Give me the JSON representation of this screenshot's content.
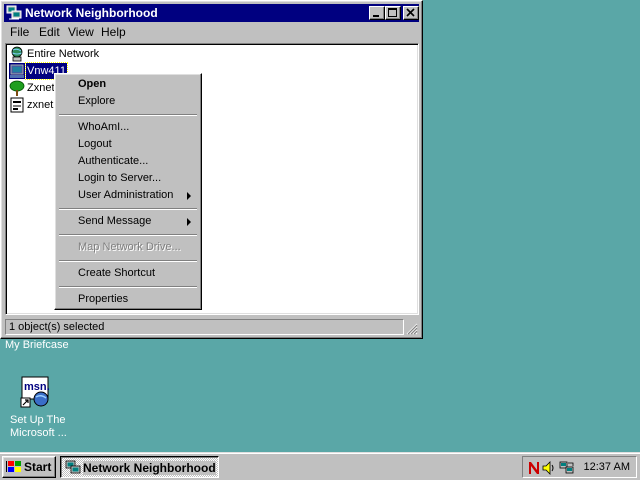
{
  "desktop": {
    "briefcase_label": "My Briefcase",
    "msn_icon_text": "msn.",
    "msn_label_line1": "Set Up The",
    "msn_label_line2": "Microsoft ..."
  },
  "window": {
    "title": "Network Neighborhood",
    "menu": {
      "file": "File",
      "edit": "Edit",
      "view": "View",
      "help": "Help"
    },
    "items": [
      {
        "label": "Entire Network",
        "icon": "network-globe-icon"
      },
      {
        "label": "Vnw411",
        "icon": "computer-icon",
        "selected": true
      },
      {
        "label": "Zxnet",
        "icon": "tree-icon"
      },
      {
        "label": "zxnet",
        "icon": "server-doc-icon"
      }
    ],
    "status": "1 object(s) selected"
  },
  "context_menu": {
    "open": "Open",
    "explore": "Explore",
    "whoami": "WhoAmI...",
    "logout": "Logout",
    "authenticate": "Authenticate...",
    "login_to_server": "Login to Server...",
    "user_administration": "User Administration",
    "send_message": "Send Message",
    "map_network_drive": "Map Network Drive...",
    "create_shortcut": "Create Shortcut",
    "properties": "Properties"
  },
  "taskbar": {
    "start_label": "Start",
    "task_label": "Network Neighborhood",
    "clock": "12:37 AM",
    "tray_icons": [
      "netware-n-icon",
      "speaker-icon",
      "network-tray-icon"
    ]
  },
  "colors": {
    "desktop": "#5aa7a7",
    "titlebar": "#000080",
    "face": "#c0c0c0",
    "tray_n": "#cc0000"
  }
}
